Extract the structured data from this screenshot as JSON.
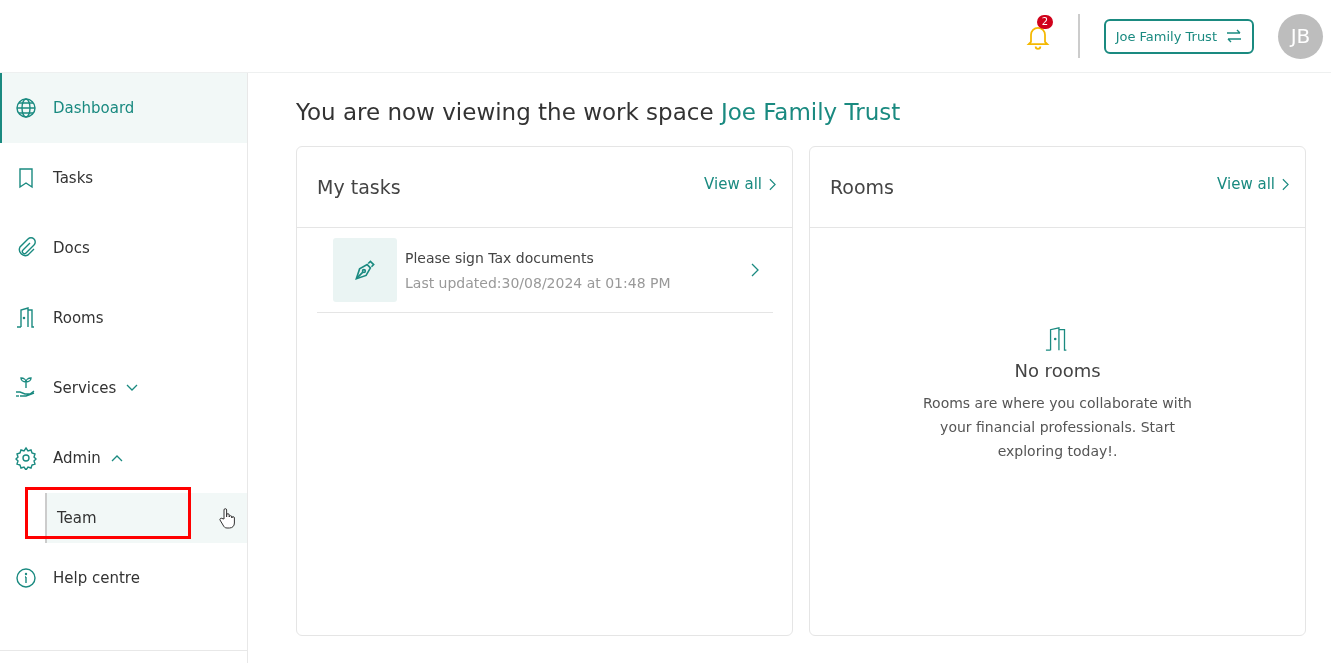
{
  "header": {
    "notification_count": "2",
    "workspace_button": "Joe Family Trust",
    "avatar_initials": "JB"
  },
  "sidebar": {
    "items": [
      {
        "label": "Dashboard",
        "selected": true
      },
      {
        "label": "Tasks",
        "selected": false
      },
      {
        "label": "Docs",
        "selected": false
      },
      {
        "label": "Rooms",
        "selected": false
      },
      {
        "label": "Services",
        "selected": false,
        "expanded": false
      },
      {
        "label": "Admin",
        "selected": false,
        "expanded": true,
        "children": [
          {
            "label": "Team",
            "selected": false,
            "hovered": true,
            "highlighted": true
          }
        ]
      },
      {
        "label": "Help centre",
        "selected": false
      }
    ]
  },
  "main": {
    "heading": "You are now viewing the work space",
    "workspace_name": "Joe Family Trust",
    "tasks_card": {
      "title": "My tasks",
      "view_all": "View all",
      "tasks": [
        {
          "title": "Please sign Tax documents",
          "updated": "Last updated:30/08/2024 at 01:48 PM"
        }
      ]
    },
    "rooms_card": {
      "title": "Rooms",
      "view_all": "View all",
      "empty_title": "No rooms",
      "empty_text": "Rooms are where you collaborate with your financial professionals. Start exploring today!."
    }
  }
}
